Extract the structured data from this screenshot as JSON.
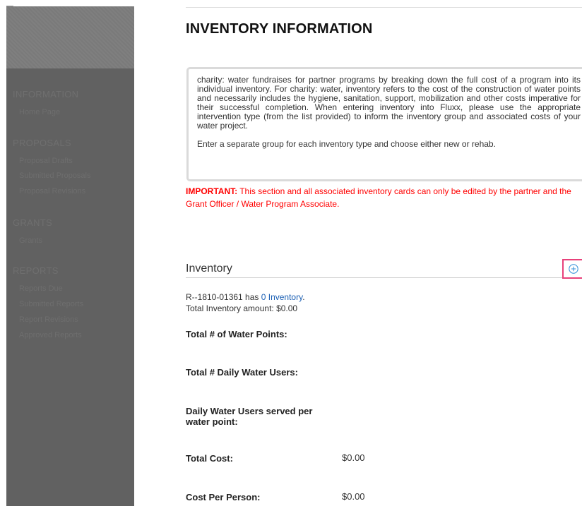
{
  "sidebar": {
    "sections": [
      {
        "title": "INFORMATION",
        "items": [
          "Home Page"
        ]
      },
      {
        "title": "PROPOSALS",
        "items": [
          "Proposal Drafts",
          "Submitted Proposals",
          "Proposal Revisions"
        ]
      },
      {
        "title": "GRANTS",
        "items": [
          "Grants"
        ]
      },
      {
        "title": "REPORTS",
        "items": [
          "Reports Due",
          "Submitted Reports",
          "Report Revisions",
          "Approved Reports"
        ]
      }
    ]
  },
  "main": {
    "title": "INVENTORY INFORMATION",
    "info_paragraph_1": "charity: water fundraises for partner programs by breaking down the full cost of a program into its individual inventory. For charity: water, inventory refers to the cost of the construction of water points and necessarily includes the hygiene, sanitation, support, mobilization and other costs imperative for their successful completion. When entering inventory into Fluxx, please use the appropriate intervention type (from the list provided) to inform the inventory group and associated costs of your water project.",
    "info_paragraph_2": "Enter a separate group for each inventory type and choose either new or rehab.",
    "important_label": "IMPORTANT:",
    "important_text": " This section and all associated inventory cards can only be edited by the partner and the Grant Officer / Water Program Associate.",
    "inventory": {
      "heading": "Inventory",
      "add_icon": "plus-circle-icon",
      "record_id": "R--1810-01361",
      "has_text": " has ",
      "count_link": "0 Inventory",
      "count_suffix": ".",
      "total_amount_label": "Total Inventory amount:",
      "total_amount_value": "$0.00"
    },
    "fields": [
      {
        "label": "Total # of Water Points:",
        "value": ""
      },
      {
        "label": "Total # Daily Water Users:",
        "value": ""
      },
      {
        "label": "Daily Water Users served per water point:",
        "value": ""
      },
      {
        "label": "Total Cost:",
        "value": "$0.00"
      },
      {
        "label": "Cost Per Person:",
        "value": "$0.00"
      }
    ]
  },
  "colors": {
    "sidebar_bg": "#616161",
    "sidebar_header_bg": "#7a7a7a",
    "important_text": "#ff0000",
    "link": "#1a5fb4",
    "add_button_border": "#e8417a",
    "add_icon": "#2f8fd8"
  }
}
